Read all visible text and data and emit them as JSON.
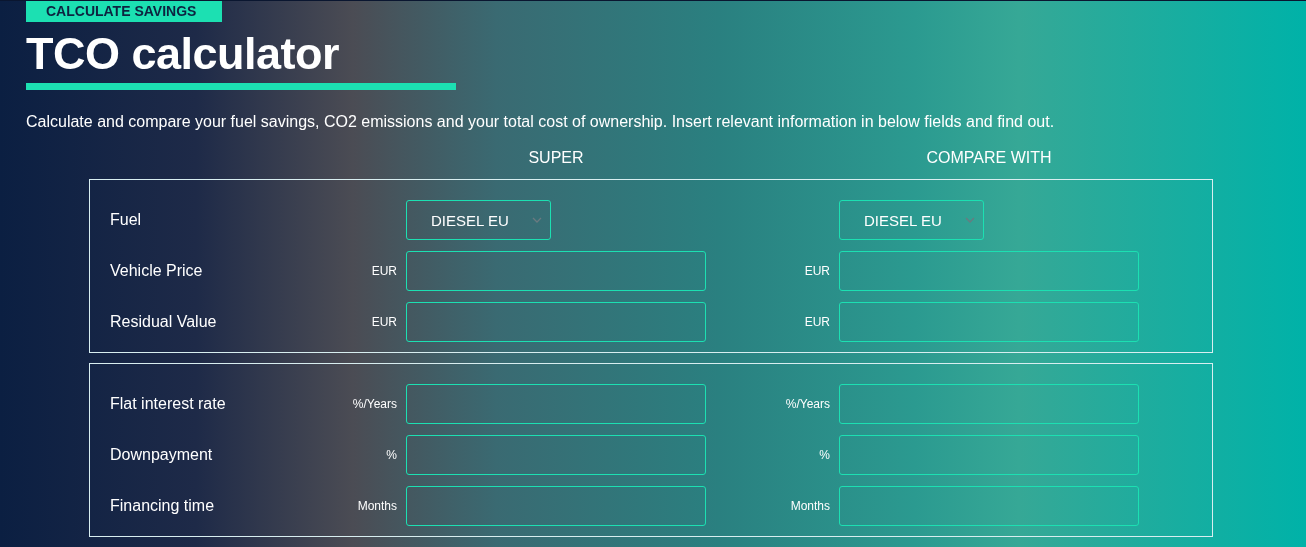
{
  "badge": "CALCULATE SAVINGS",
  "title": "TCO calculator",
  "description": "Calculate and compare your fuel savings, CO2 emissions and your total cost of ownership. Insert relevant information in below fields and find out.",
  "columns": [
    "SUPER",
    "COMPARE WITH"
  ],
  "sections": [
    {
      "rows": [
        {
          "kind": "select",
          "label": "Fuel",
          "fields": [
            {
              "value": "DIESEL EU"
            },
            {
              "value": "DIESEL EU"
            }
          ]
        },
        {
          "kind": "input",
          "label": "Vehicle Price",
          "fields": [
            {
              "unit": "EUR"
            },
            {
              "unit": "EUR"
            }
          ]
        },
        {
          "kind": "input",
          "label": "Residual Value",
          "fields": [
            {
              "unit": "EUR"
            },
            {
              "unit": "EUR"
            }
          ]
        }
      ]
    },
    {
      "rows": [
        {
          "kind": "input",
          "label": "Flat interest rate",
          "fields": [
            {
              "unit": "%/Years"
            },
            {
              "unit": "%/Years"
            }
          ]
        },
        {
          "kind": "input",
          "label": "Downpayment",
          "fields": [
            {
              "unit": "%"
            },
            {
              "unit": "%"
            }
          ]
        },
        {
          "kind": "input",
          "label": "Financing time",
          "fields": [
            {
              "unit": "Months"
            },
            {
              "unit": "Months"
            }
          ]
        }
      ]
    }
  ]
}
